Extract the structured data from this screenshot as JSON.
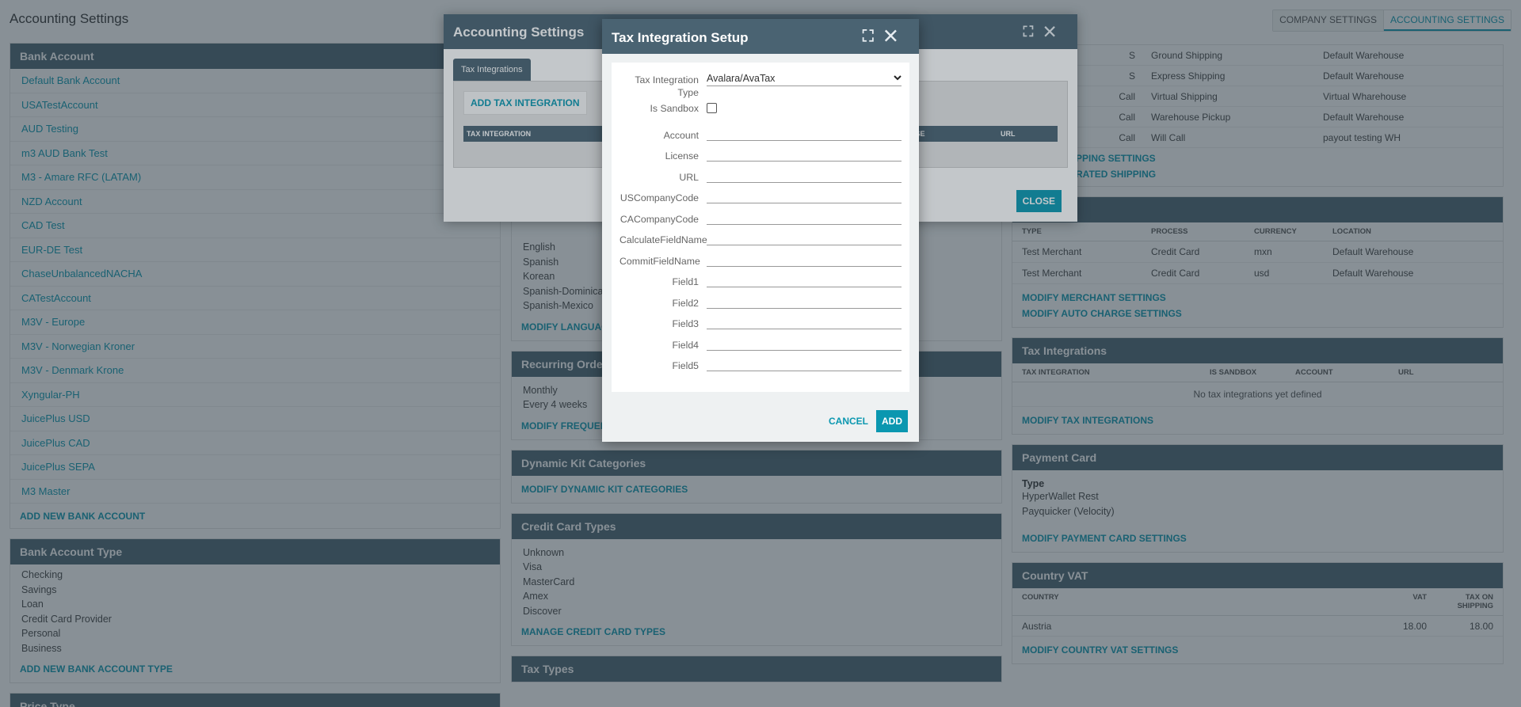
{
  "page": {
    "title": "Accounting Settings",
    "tabs": [
      "COMPANY SETTINGS",
      "ACCOUNTING SETTINGS"
    ]
  },
  "bank_account": {
    "header": "Bank Account",
    "items": [
      "Default Bank Account",
      "USATestAccount",
      "AUD Testing",
      "m3 AUD Bank Test",
      "M3 - Amare RFC (LATAM)",
      "NZD Account",
      "CAD Test",
      "EUR-DE Test",
      "ChaseUnbalancedNACHA",
      "CATestAccount",
      "M3V - Europe",
      "M3V - Norwegian Kroner",
      "M3V - Denmark Krone",
      "Xyngular-PH",
      "JuicePlus USD",
      "JuicePlus CAD",
      "JuicePlus SEPA",
      "M3 Master"
    ],
    "action": "ADD NEW BANK ACCOUNT"
  },
  "bank_account_type": {
    "header": "Bank Account Type",
    "items": [
      "Checking",
      "Savings",
      "Loan",
      "Credit Card Provider",
      "Personal",
      "Business"
    ],
    "action": "ADD NEW BANK ACCOUNT TYPE"
  },
  "price_type": {
    "header": "Price Type"
  },
  "languages": {
    "items": [
      "English",
      "Spanish",
      "Korean",
      "Spanish-Dominican",
      "Spanish-Mexico"
    ],
    "action": "MODIFY LANGUAGE"
  },
  "recurring": {
    "header": "Recurring Order F",
    "items": [
      "Monthly",
      "Every 4 weeks"
    ],
    "action": "MODIFY FREQUENCY SETTINGS"
  },
  "kits": {
    "header": "Dynamic Kit Categories",
    "action": "MODIFY DYNAMIC KIT CATEGORIES"
  },
  "cc_types": {
    "header": "Credit Card Types",
    "items": [
      "Unknown",
      "Visa",
      "MasterCard",
      "Amex",
      "Discover"
    ],
    "action": "MANAGE CREDIT CARD TYPES"
  },
  "tax_types": {
    "header": "Tax Types"
  },
  "shipping": {
    "rows": [
      [
        "S",
        "Ground Shipping",
        "Default Warehouse"
      ],
      [
        "S",
        "Express Shipping",
        "Default Warehouse"
      ],
      [
        "Call",
        "Virtual Shipping",
        "Virtual Wharehouse"
      ],
      [
        "Call",
        "Warehouse Pickup",
        "Default Warehouse"
      ],
      [
        "Call",
        "Will Call",
        "payout testing WH"
      ]
    ],
    "actions": [
      "PPING SETTINGS",
      "RATED SHIPPING"
    ]
  },
  "merchant": {
    "header": "Merchant",
    "columns": [
      "TYPE",
      "PROCESS",
      "CURRENCY",
      "LOCATION"
    ],
    "rows": [
      [
        "Test Merchant",
        "Credit Card",
        "mxn",
        "Default Warehouse"
      ],
      [
        "Test Merchant",
        "Credit Card",
        "usd",
        "Default Warehouse"
      ]
    ],
    "actions": [
      "MODIFY MERCHANT SETTINGS",
      "MODIFY AUTO CHARGE SETTINGS"
    ]
  },
  "tax_integrations": {
    "header": "Tax Integrations",
    "columns": [
      "TAX INTEGRATION",
      "IS SANDBOX",
      "ACCOUNT",
      "URL"
    ],
    "empty": "No tax integrations yet defined",
    "action": "MODIFY TAX INTEGRATIONS"
  },
  "payment_card": {
    "header": "Payment Card",
    "type_label": "Type",
    "items": [
      "HyperWallet Rest",
      "Payquicker (Velocity)"
    ],
    "action": "MODIFY PAYMENT CARD SETTINGS"
  },
  "country_vat": {
    "header": "Country VAT",
    "columns": [
      "COUNTRY",
      "VAT",
      "TAX ON SHIPPING"
    ],
    "rows": [
      [
        "Austria",
        "18.00",
        "18.00"
      ]
    ],
    "action": "MODIFY COUNTRY VAT SETTINGS"
  },
  "modal_accounting": {
    "title": "Accounting Settings",
    "tab": "Tax Integrations",
    "add": "ADD TAX INTEGRATION",
    "columns": [
      "TAX INTEGRATION",
      "NSE",
      "URL"
    ],
    "close": "CLOSE"
  },
  "modal_tax": {
    "title": "Tax Integration Setup",
    "type_label": "Tax Integration Type",
    "type_value": "Avalara/AvaTax",
    "sandbox_label": "Is Sandbox",
    "fields": [
      "Account",
      "License",
      "URL",
      "USCompanyCode",
      "CACompanyCode",
      "CalculateFieldName",
      "CommitFieldName",
      "Field1",
      "Field2",
      "Field3",
      "Field4",
      "Field5"
    ],
    "cancel": "CANCEL",
    "add": "ADD"
  }
}
